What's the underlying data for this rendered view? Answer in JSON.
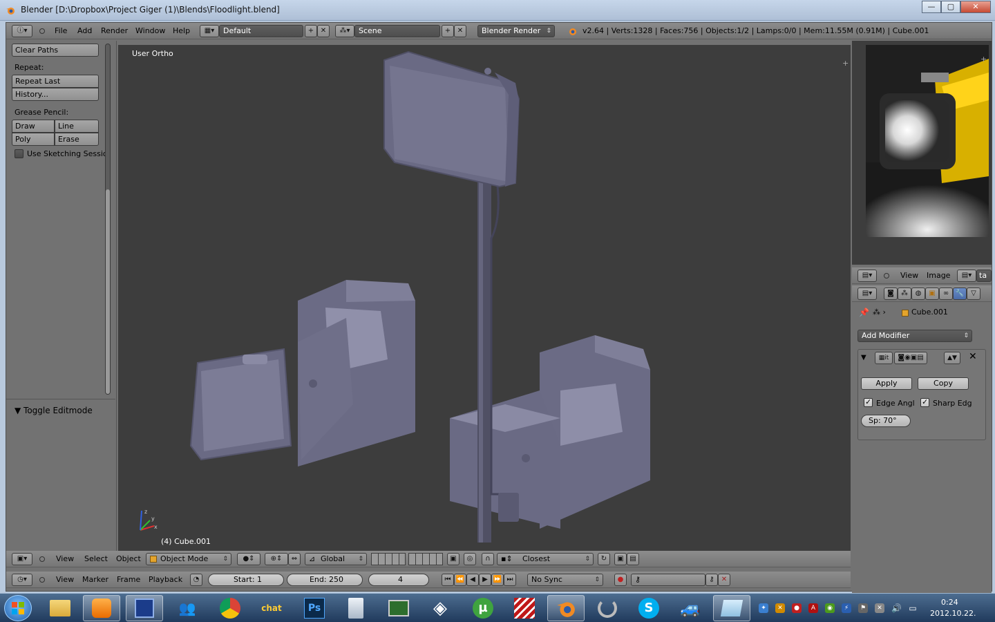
{
  "window": {
    "title": "Blender [D:\\Dropbox\\Project Giger (1)\\Blends\\Floodlight.blend]",
    "min_label": "—",
    "max_label": "▢",
    "close_label": "✕"
  },
  "info_header": {
    "menus": [
      "File",
      "Add",
      "Render",
      "Window",
      "Help"
    ],
    "layout": "Default",
    "scene": "Scene",
    "engine": "Blender Render",
    "stats": "v2.64 | Verts:1328 | Faces:756 | Objects:1/2 | Lamps:0/0 | Mem:11.55M (0.91M) | Cube.001"
  },
  "tool_shelf": {
    "clear_paths": "Clear Paths",
    "repeat_label": "Repeat:",
    "repeat_last": "Repeat Last",
    "history": "History...",
    "grease_label": "Grease Pencil:",
    "draw": "Draw",
    "line": "Line",
    "poly": "Poly",
    "erase": "Erase",
    "use_sketching": "Use Sketching Sessio",
    "toggle_editmode": "Toggle Editmode"
  },
  "viewport": {
    "view_name": "User Ortho",
    "object_label": "(4) Cube.001",
    "axis_colors": {
      "x": "#e03030",
      "y": "#30c030",
      "z": "#3060e0"
    }
  },
  "viewport_header": {
    "menus": [
      "View",
      "Select",
      "Object"
    ],
    "mode": "Object Mode",
    "orientation": "Global",
    "snap": "Closest"
  },
  "timeline_header": {
    "menus": [
      "View",
      "Marker",
      "Frame",
      "Playback"
    ],
    "start": "Start: 1",
    "end": "End: 250",
    "current": "4",
    "sync": "No Sync"
  },
  "image_editor_header": {
    "menus": [
      "View",
      "Image"
    ],
    "browse": "ta"
  },
  "properties": {
    "object_name": "Cube.001",
    "add_modifier": "Add Modifier",
    "modifier_name": "it",
    "apply": "Apply",
    "copy": "Copy",
    "edge_angle": "Edge Angl",
    "sharp_edges": "Sharp Edg",
    "split_angle": "Sp: 70°"
  },
  "taskbar": {
    "apps": [
      "explorer",
      "media-player",
      "save",
      "messenger",
      "chrome",
      "chat",
      "photoshop",
      "calculator",
      "monitor",
      "unity",
      "utorrent",
      "stripes",
      "blender",
      "circle",
      "skype",
      "car"
    ],
    "chat_label": "chat",
    "ps_label": "Ps",
    "time": "0:24",
    "date": "2012.10.22."
  }
}
